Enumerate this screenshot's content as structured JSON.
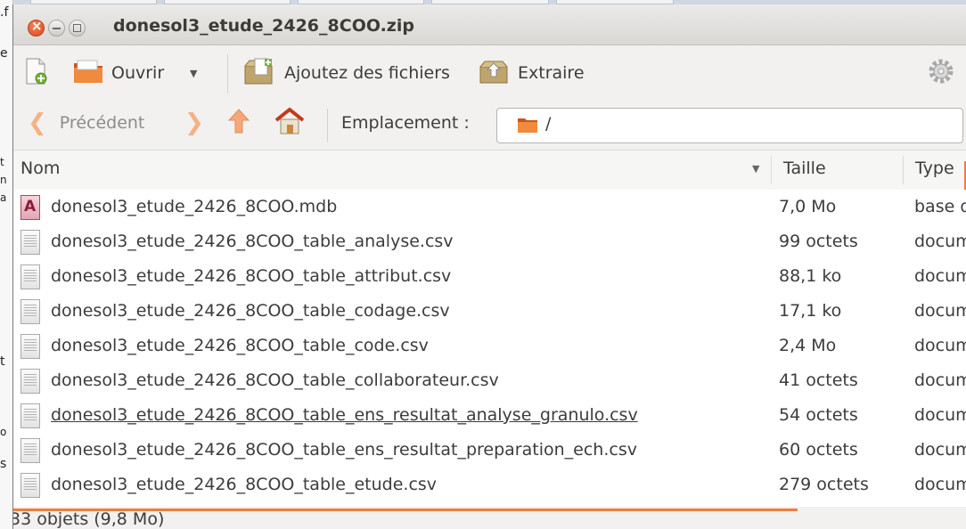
{
  "window": {
    "title": "donesol3_etude_2426_8COO.zip"
  },
  "toolbar": {
    "new_icon": "new-archive-icon",
    "open_label": "Ouvrir",
    "open_dropdown_icon": "triangle-down-icon",
    "add_files_label": "Ajoutez des fichiers",
    "extract_label": "Extraire",
    "settings_icon": "gear-icon"
  },
  "location": {
    "back_label": "Précédent",
    "label": "Emplacement :",
    "path": "/"
  },
  "columns": {
    "name": "Nom",
    "size": "Taille",
    "type": "Type"
  },
  "files": [
    {
      "name": "donesol3_etude_2426_8COO.mdb",
      "size": "7,0 Mo",
      "type": "base d",
      "icon": "database-file-icon"
    },
    {
      "name": "donesol3_etude_2426_8COO_table_analyse.csv",
      "size": "99 octets",
      "type": "docum",
      "icon": "text-file-icon"
    },
    {
      "name": "donesol3_etude_2426_8COO_table_attribut.csv",
      "size": "88,1 ko",
      "type": "docum",
      "icon": "text-file-icon"
    },
    {
      "name": "donesol3_etude_2426_8COO_table_codage.csv",
      "size": "17,1 ko",
      "type": "docum",
      "icon": "text-file-icon"
    },
    {
      "name": "donesol3_etude_2426_8COO_table_code.csv",
      "size": "2,4 Mo",
      "type": "docum",
      "icon": "text-file-icon"
    },
    {
      "name": "donesol3_etude_2426_8COO_table_collaborateur.csv",
      "size": "41 octets",
      "type": "docum",
      "icon": "text-file-icon"
    },
    {
      "name": "donesol3_etude_2426_8COO_table_ens_resultat_analyse_granulo.csv",
      "size": "54 octets",
      "type": "docum",
      "icon": "text-file-icon"
    },
    {
      "name": "donesol3_etude_2426_8COO_table_ens_resultat_preparation_ech.csv",
      "size": "60 octets",
      "type": "docum",
      "icon": "text-file-icon"
    },
    {
      "name": "donesol3_etude_2426_8COO_table_etude.csv",
      "size": "279 octets",
      "type": "docum",
      "icon": "text-file-icon"
    }
  ],
  "status": {
    "text": "33 objets (9,8 Mo)"
  },
  "background_app": {
    "fragments": [
      ".f",
      "e",
      "t",
      "n",
      "a",
      "t",
      "o",
      "s"
    ]
  },
  "colors": {
    "accent": "#ee7e42",
    "close_button": "#e05a2a",
    "folder": "#e8702a"
  }
}
